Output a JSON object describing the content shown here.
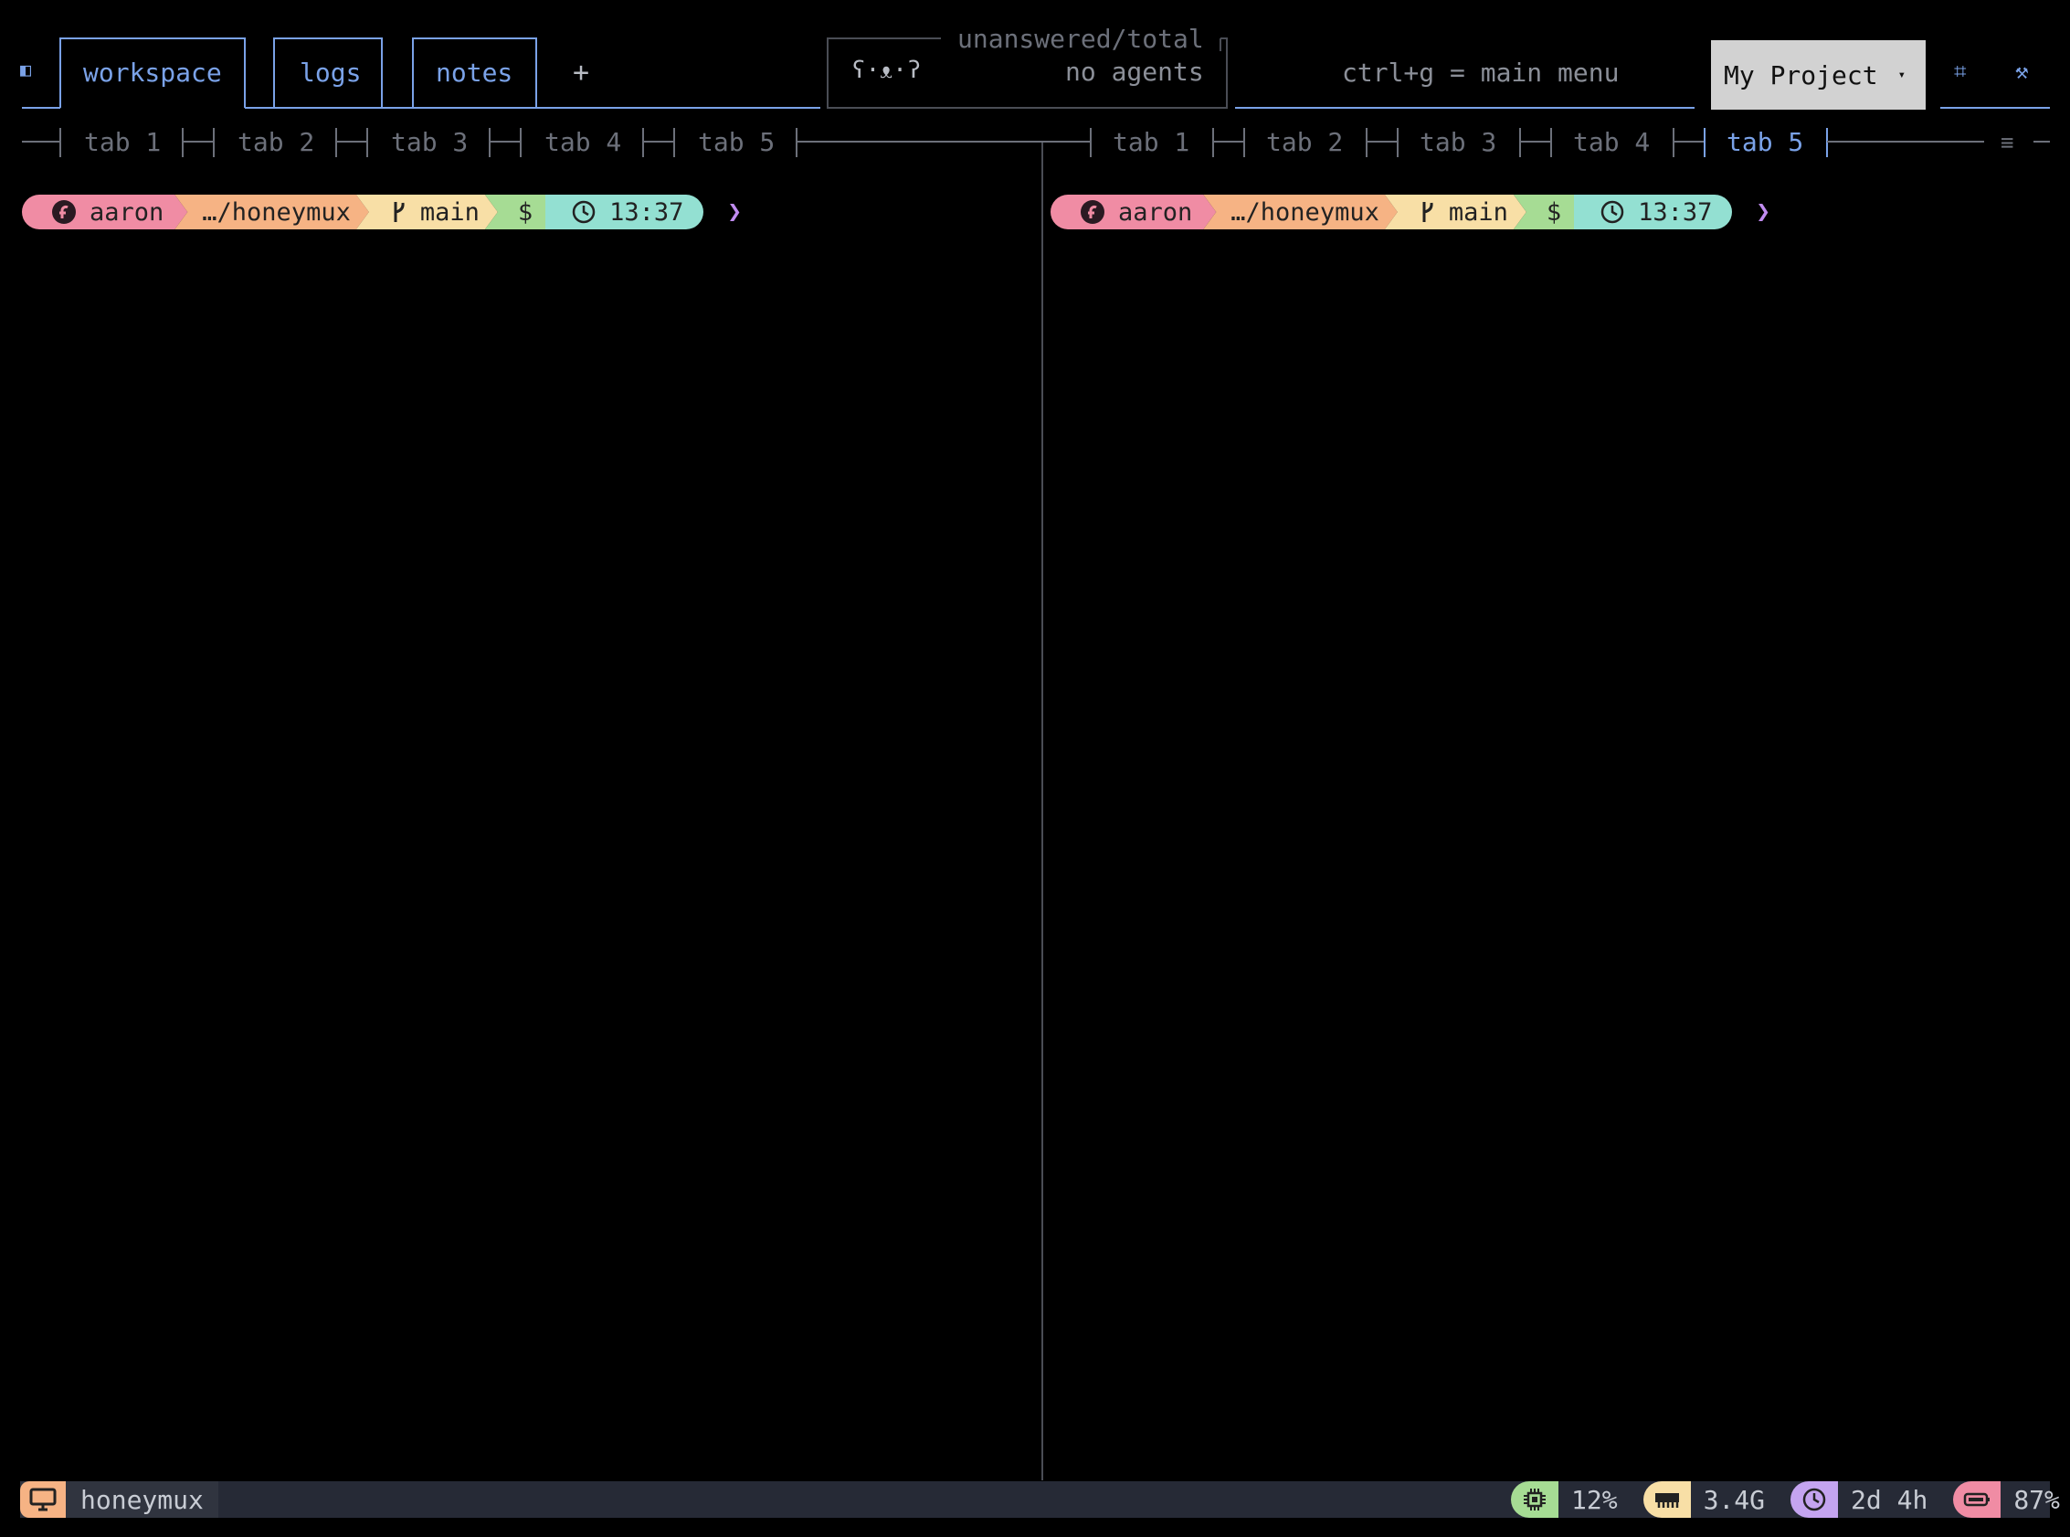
{
  "header": {
    "sidebar_toggle_glyph": "◧",
    "tabs": [
      {
        "label": "workspace",
        "active": true
      },
      {
        "label": "logs",
        "active": false
      },
      {
        "label": "notes",
        "active": false
      }
    ],
    "add_tab_label": "+",
    "agents": {
      "caption": "unanswered/total",
      "face": "ʕ·ᴥ·ʔ",
      "status": "no agents"
    },
    "hint": "ctrl+g = main menu",
    "project": {
      "label": "My Project",
      "caret": "▾"
    },
    "icons": {
      "grid": "⌗",
      "tools": "⚒"
    }
  },
  "panes": [
    {
      "tabs": [
        "tab 1",
        "tab 2",
        "tab 3",
        "tab 4",
        "tab 5"
      ],
      "active_tab": -1,
      "prompt": {
        "user": "aaron",
        "path": "…/honeymux",
        "branch": "main",
        "shell": "$",
        "time": "13:37",
        "caret": "❯"
      }
    },
    {
      "tabs": [
        "tab 1",
        "tab 2",
        "tab 3",
        "tab 4",
        "tab 5"
      ],
      "active_tab": 4,
      "menu_glyph": "≡",
      "prompt": {
        "user": "aaron",
        "path": "…/honeymux",
        "branch": "main",
        "shell": "$",
        "time": "13:37",
        "caret": "❯"
      }
    }
  ],
  "statusbar": {
    "session": "honeymux",
    "cpu": "12%",
    "memory": "3.4G",
    "uptime": "2d 4h",
    "battery": "87%"
  },
  "colors": {
    "accent": "#7aa2e8",
    "user": "#f08ca4",
    "path": "#f6b384",
    "branch": "#f8dfa6",
    "shell": "#a6dc94",
    "time": "#93e0d2",
    "session": "#f6b384",
    "cpu": "#a6dc94",
    "memory": "#f8dfa6",
    "uptime": "#c4a4f0",
    "battery": "#f08ca4"
  }
}
